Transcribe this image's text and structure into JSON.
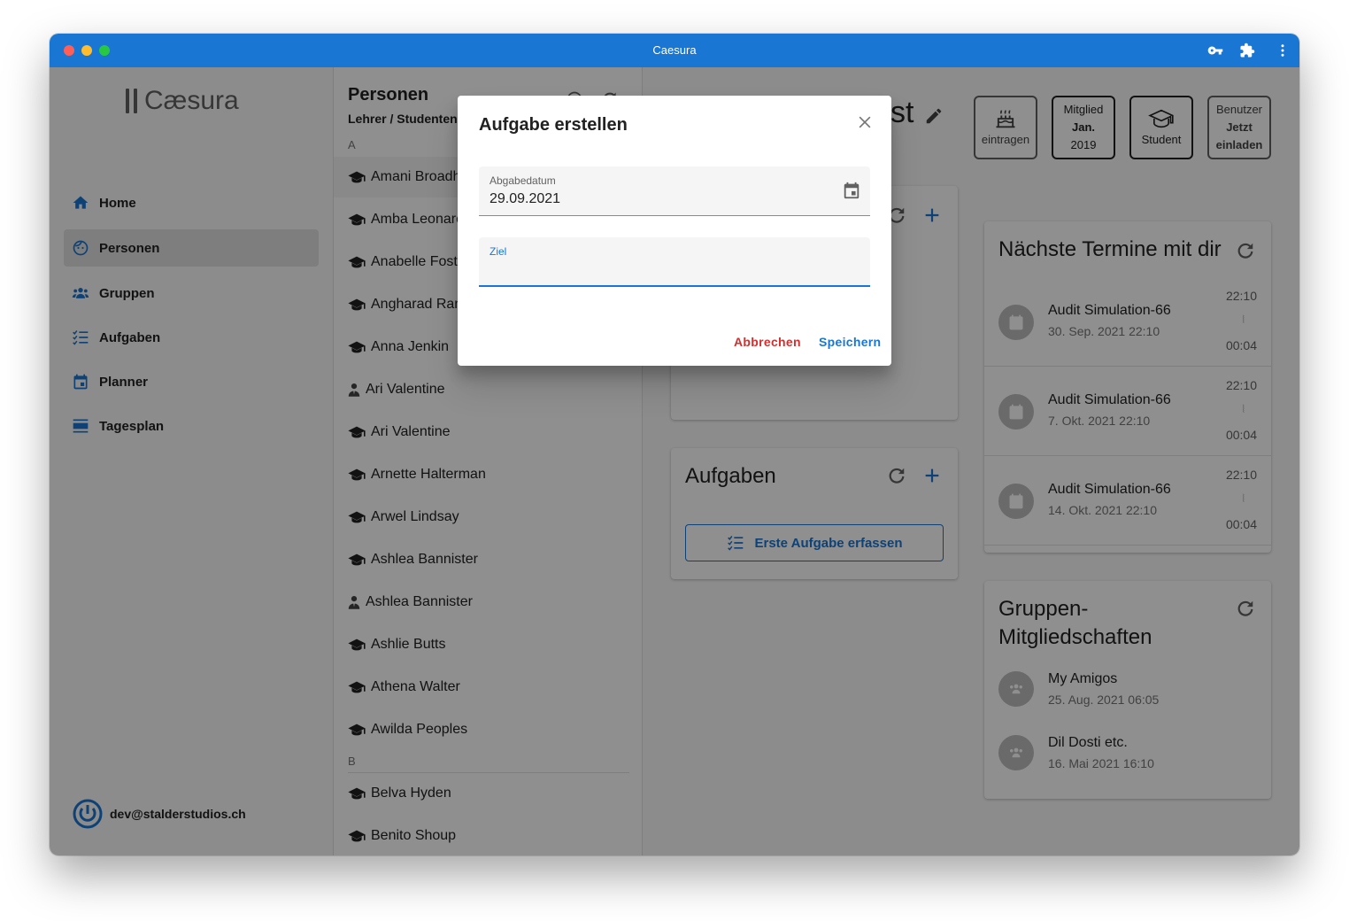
{
  "window": {
    "title": "Caesura"
  },
  "sidebar": {
    "logo_text": "Cæsura",
    "items": [
      {
        "label": "Home",
        "icon": "home-icon"
      },
      {
        "label": "Personen",
        "icon": "person-face-icon",
        "active": true
      },
      {
        "label": "Gruppen",
        "icon": "group-icon"
      },
      {
        "label": "Aufgaben",
        "icon": "checklist-icon"
      },
      {
        "label": "Planner",
        "icon": "calendar-icon"
      },
      {
        "label": "Tagesplan",
        "icon": "day-view-icon"
      }
    ],
    "user_email": "dev@stalderstudios.ch"
  },
  "people": {
    "title": "Personen",
    "subtitle": "Lehrer / Studenten /",
    "letters": [
      "A",
      "B"
    ],
    "items": [
      {
        "name": "Amani Broadh",
        "role": "student"
      },
      {
        "name": "Amba Leonarc",
        "role": "student"
      },
      {
        "name": "Anabelle Foste",
        "role": "student"
      },
      {
        "name": "Angharad Ran",
        "role": "student"
      },
      {
        "name": "Anna Jenkin",
        "role": "student"
      },
      {
        "name": "Ari Valentine",
        "role": "teacher"
      },
      {
        "name": "Ari Valentine",
        "role": "student"
      },
      {
        "name": "Arnette Halterman",
        "role": "student"
      },
      {
        "name": "Arwel Lindsay",
        "role": "student"
      },
      {
        "name": "Ashlea Bannister",
        "role": "student"
      },
      {
        "name": "Ashlea Bannister",
        "role": "teacher"
      },
      {
        "name": "Ashlie Butts",
        "role": "student"
      },
      {
        "name": "Athena Walter",
        "role": "student"
      },
      {
        "name": "Awilda Peoples",
        "role": "student"
      }
    ],
    "items_b": [
      {
        "name": "Belva Hyden",
        "role": "student"
      },
      {
        "name": "Benito Shoup",
        "role": "student"
      }
    ]
  },
  "main": {
    "header_title_fragment": "st",
    "badges": [
      {
        "label": "eintragen",
        "icon": "cake-icon"
      },
      {
        "line1": "Mitglied",
        "line2": "Jan.",
        "line3": "2019"
      },
      {
        "label": "Student",
        "icon": "school-icon"
      },
      {
        "line1": "Benutzer",
        "line2": "Jetzt",
        "line3": "einladen"
      }
    ],
    "tasks_card": {
      "title": "Aufgaben",
      "button_label": "Erste Aufgabe erfassen"
    },
    "events_card": {
      "title": "Nächste Termine mit dir",
      "events": [
        {
          "title": "Audit Simulation-66",
          "date": "30. Sep. 2021 22:10",
          "start": "22:10",
          "end": "00:04"
        },
        {
          "title": "Audit Simulation-66",
          "date": "7. Okt. 2021 22:10",
          "start": "22:10",
          "end": "00:04"
        },
        {
          "title": "Audit Simulation-66",
          "date": "14. Okt. 2021 22:10",
          "start": "22:10",
          "end": "00:04"
        }
      ]
    },
    "groups_card": {
      "title_line1": "Gruppen-",
      "title_line2": "Mitgliedschaften",
      "groups": [
        {
          "name": "My Amigos",
          "date": "25. Aug. 2021 06:05"
        },
        {
          "name": "Dil Dosti etc.",
          "date": "16. Mai 2021 16:10"
        }
      ]
    }
  },
  "dialog": {
    "title": "Aufgabe erstellen",
    "due_label": "Abgabedatum",
    "due_value": "29.09.2021",
    "goal_label": "Ziel",
    "goal_value": "",
    "cancel_label": "Abbrechen",
    "save_label": "Speichern"
  },
  "colors": {
    "primary": "#1976d2",
    "cancel": "#d32f2f"
  }
}
